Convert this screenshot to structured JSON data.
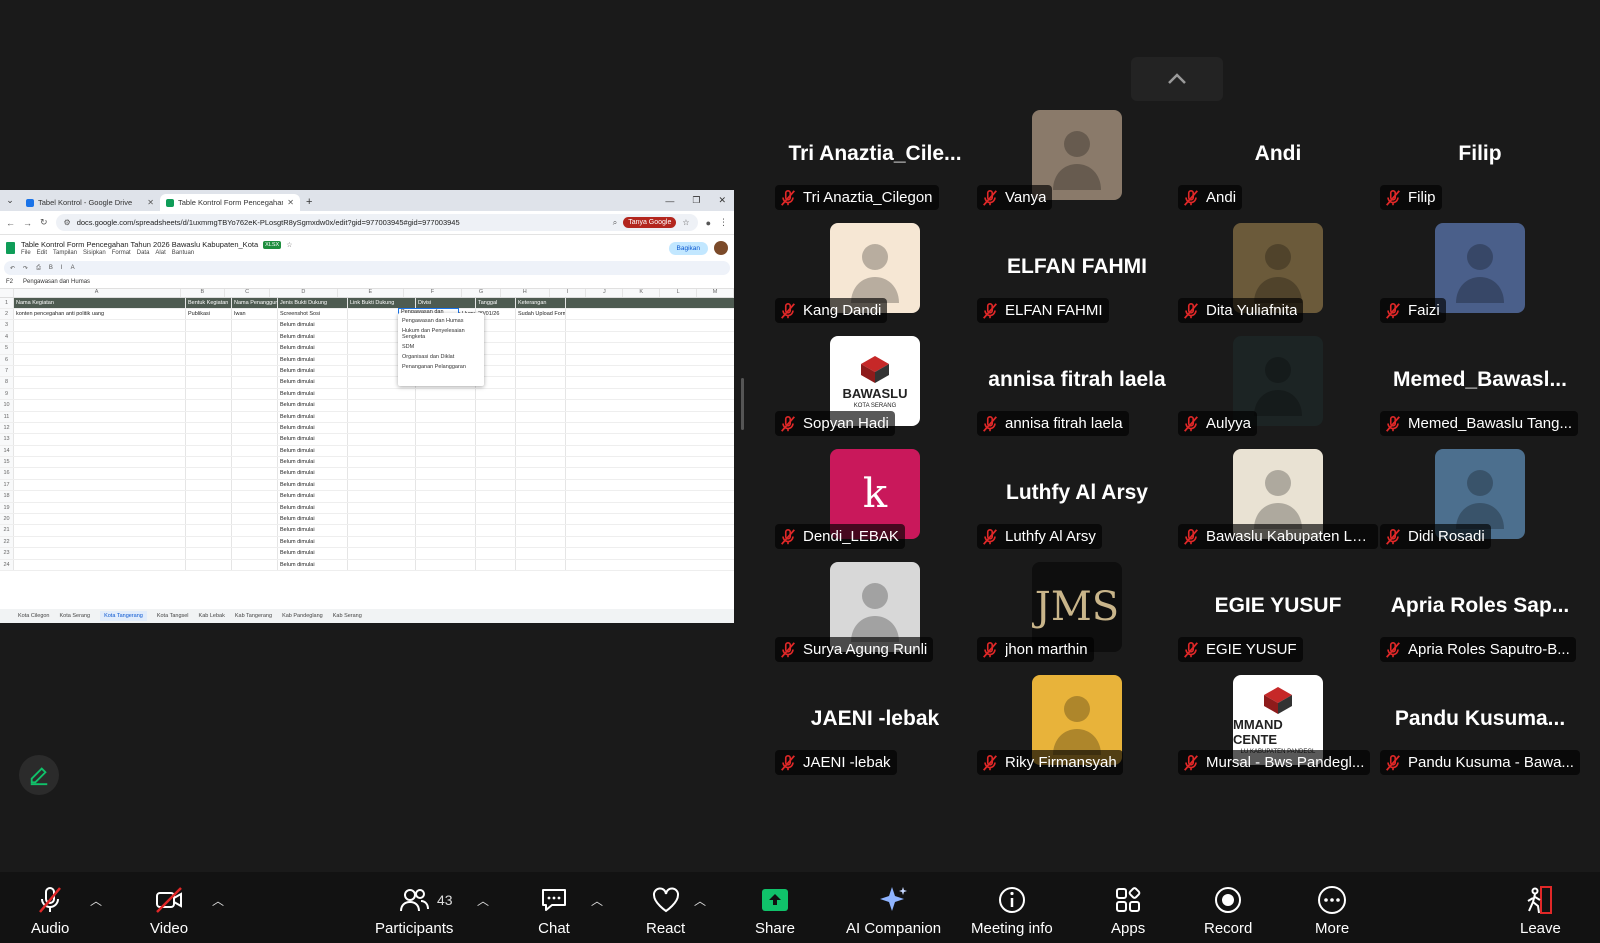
{
  "browser": {
    "tabs": [
      {
        "title": "Tabel Kontrol - Google Drive",
        "active": false
      },
      {
        "title": "Table Kontrol Form Pencegahan",
        "active": true
      }
    ],
    "url": "docs.google.com/spreadsheets/d/1uxmmgTBYo762eK-PLosgtR8ySgmxdw0x/edit?gid=977003945#gid=977003945",
    "ask_google": "Tanya Google"
  },
  "sheet": {
    "title": "Table Kontrol Form Pencegahan Tahun 2026 Bawaslu Kabupaten_Kota",
    "badge": "XLSX",
    "menus": [
      "File",
      "Edit",
      "Tampilan",
      "Sisipkan",
      "Format",
      "Data",
      "Alat",
      "Bantuan"
    ],
    "share_label": "Bagikan",
    "cell_ref": "F2",
    "formula": "Pengawasan dan Humas",
    "columns": [
      "A",
      "B",
      "C",
      "D",
      "E",
      "F",
      "G",
      "H",
      "I",
      "J",
      "K",
      "L",
      "M"
    ],
    "header_row": [
      "Nama Kegiatan",
      "Bentuk Kegiatan",
      "Nama Penanggungj.",
      "Jenis Bukti Dukung",
      "Link Bukti Dukung",
      "Divisi",
      "Tanggal",
      "Keterangan"
    ],
    "first_row": [
      "konten pencegahan anti politik uang",
      "Publikasi",
      "Iwan",
      "Screenshot Sosi",
      "",
      "Pengawasan dan Humas",
      "29/01/26",
      "Sudah Upload Form Pencegahan"
    ],
    "status_text": "Belum dimulai",
    "dropdown_options": [
      "Pengawasan dan Humas",
      "Hukum dan Penyelesaian Sengketa",
      "SDM",
      "Organisasi dan Diklat",
      "Penanganan Pelanggaran"
    ],
    "sheet_tabs": [
      "Kota Cilegon",
      "Kota Serang",
      "Kota Tangerang",
      "Kota Tangsel",
      "Kab Lebak",
      "Kab Tangerang",
      "Kab Pandeglang",
      "Kab Serang"
    ],
    "selected_tab": "Kota Tangerang"
  },
  "participants": [
    {
      "display": "Tri  Anaztia_Cile...",
      "label": "Tri Anaztia_Cilegon",
      "type": "name"
    },
    {
      "display": "",
      "label": "Vanya",
      "type": "photo",
      "color": "#8a7a6a"
    },
    {
      "display": "Andi",
      "label": "Andi",
      "type": "name"
    },
    {
      "display": "Filip",
      "label": "Filip",
      "type": "name"
    },
    {
      "display": "",
      "label": "Kang Dandi",
      "type": "photo",
      "color": "#f6e7d4"
    },
    {
      "display": "ELFAN FAHMI",
      "label": "ELFAN FAHMI",
      "type": "name"
    },
    {
      "display": "",
      "label": "Dita Yuliafnita",
      "type": "photo",
      "color": "#6b5a3a"
    },
    {
      "display": "",
      "label": "Faizi",
      "type": "photo",
      "color": "#4a5f8a"
    },
    {
      "display": "BAWASLU",
      "label": "Sopyan Hadi",
      "type": "logo",
      "color": "#ffffff",
      "sub": "KOTA SERANG"
    },
    {
      "display": "annisa fitrah laela",
      "label": "annisa fitrah laela",
      "type": "name"
    },
    {
      "display": "",
      "label": "Aulyya",
      "type": "photo",
      "color": "#1c2424"
    },
    {
      "display": "Memed_Bawasl...",
      "label": "Memed_Bawaslu Tang...",
      "type": "name"
    },
    {
      "display": "k",
      "label": "Dendi_LEBAK",
      "type": "letter",
      "color": "#c9185b"
    },
    {
      "display": "Luthfy Al Arsy",
      "label": "Luthfy Al Arsy",
      "type": "name"
    },
    {
      "display": "",
      "label": "Bawaslu Kabupaten Le...",
      "type": "photo",
      "color": "#e9e2d3"
    },
    {
      "display": "",
      "label": "Didi Rosadi",
      "type": "photo",
      "color": "#4c6f8e"
    },
    {
      "display": "",
      "label": "Surya Agung Runli",
      "type": "photo",
      "color": "#d8d8d8"
    },
    {
      "display": "JMS",
      "label": "jhon marthin",
      "type": "letter",
      "color": "#0e0e0e"
    },
    {
      "display": "EGIE YUSUF",
      "label": "EGIE YUSUF",
      "type": "name"
    },
    {
      "display": "Apria  Roles  Sap...",
      "label": "Apria Roles Saputro-B...",
      "type": "name"
    },
    {
      "display": "JAENI -lebak",
      "label": "JAENI -lebak",
      "type": "name"
    },
    {
      "display": "",
      "label": "Riky Firmansyah",
      "type": "photo",
      "color": "#e8b33a"
    },
    {
      "display": "MMAND CENTE",
      "label": "Mursal - Bws Pandegl...",
      "type": "logo",
      "color": "#ffffff",
      "sub": "LU KABUPATEN PANDEGL"
    },
    {
      "display": "Pandu  Kusuma...",
      "label": "Pandu Kusuma - Bawa...",
      "type": "name"
    }
  ],
  "toolbar": {
    "audio": "Audio",
    "video": "Video",
    "participants": "Participants",
    "participant_count": "43",
    "chat": "Chat",
    "react": "React",
    "share": "Share",
    "ai_companion": "AI Companion",
    "meeting_info": "Meeting info",
    "apps": "Apps",
    "record": "Record",
    "more": "More",
    "leave": "Leave"
  },
  "colors": {
    "share_green": "#10c26a",
    "muted_red": "#e02828",
    "toolbar_bg": "#121212"
  }
}
